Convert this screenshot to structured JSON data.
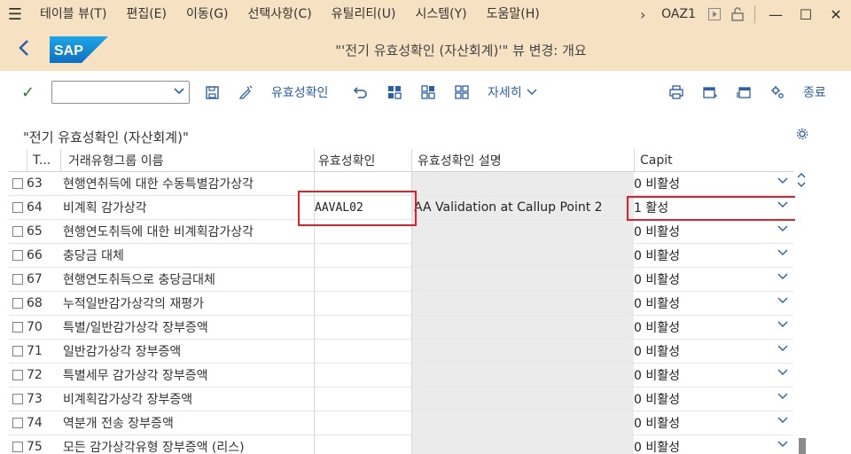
{
  "menubar": {
    "items": [
      "테이블 뷰(T)",
      "편집(E)",
      "이동(G)",
      "선택사항(C)",
      "유틸리티(U)",
      "시스템(Y)",
      "도움말(H)"
    ],
    "tcode": "OAZ1"
  },
  "titlebar": {
    "logo": "SAP",
    "title": "\"'전기 유효성확인 (자산회계)'\" 뷰 변경: 개요"
  },
  "toolbar": {
    "validation_label": "유효성확인",
    "details_label": "자세히",
    "exit_label": "종료"
  },
  "section": {
    "title": "\"전기 유효성확인 (자산회계)\""
  },
  "table": {
    "columns": [
      "T...",
      "거래유형그룹 이름",
      "유효성확인",
      "유효성확인 설명",
      "Capit"
    ],
    "rows": [
      {
        "t": "63",
        "name": "현행연취득에 대한 수동특별감가상각",
        "validation": "",
        "description": "",
        "capit": "0 비활성"
      },
      {
        "t": "64",
        "name": "비계획 감가상각",
        "validation": "AAVAL02",
        "description": "AA Validation at Callup Point 2",
        "capit": "1 활성"
      },
      {
        "t": "65",
        "name": "현행연도취득에 대한 비계획감가상각",
        "validation": "",
        "description": "",
        "capit": "0 비활성"
      },
      {
        "t": "66",
        "name": "충당금 대체",
        "validation": "",
        "description": "",
        "capit": "0 비활성"
      },
      {
        "t": "67",
        "name": "현행연도취득으로 충당금대체",
        "validation": "",
        "description": "",
        "capit": "0 비활성"
      },
      {
        "t": "68",
        "name": "누적일반감가상각의 재평가",
        "validation": "",
        "description": "",
        "capit": "0 비활성"
      },
      {
        "t": "70",
        "name": "특별/일반감가상각 장부증액",
        "validation": "",
        "description": "",
        "capit": "0 비활성"
      },
      {
        "t": "71",
        "name": "일반감가상각 장부증액",
        "validation": "",
        "description": "",
        "capit": "0 비활성"
      },
      {
        "t": "72",
        "name": "특별세무 감가상각 장부증액",
        "validation": "",
        "description": "",
        "capit": "0 비활성"
      },
      {
        "t": "73",
        "name": "비계획감가상각 장부증액",
        "validation": "",
        "description": "",
        "capit": "0 비활성"
      },
      {
        "t": "74",
        "name": "역분개 전송 장부증액",
        "validation": "",
        "description": "",
        "capit": "0 비활성"
      },
      {
        "t": "75",
        "name": "모든 감가상각유형 장부증액 (리스)",
        "validation": "",
        "description": "",
        "capit": "0 비활성"
      }
    ]
  },
  "colors": {
    "shell": "#f6e2c2",
    "accent": "#2b5fa6",
    "highlight": "#e0202a"
  }
}
